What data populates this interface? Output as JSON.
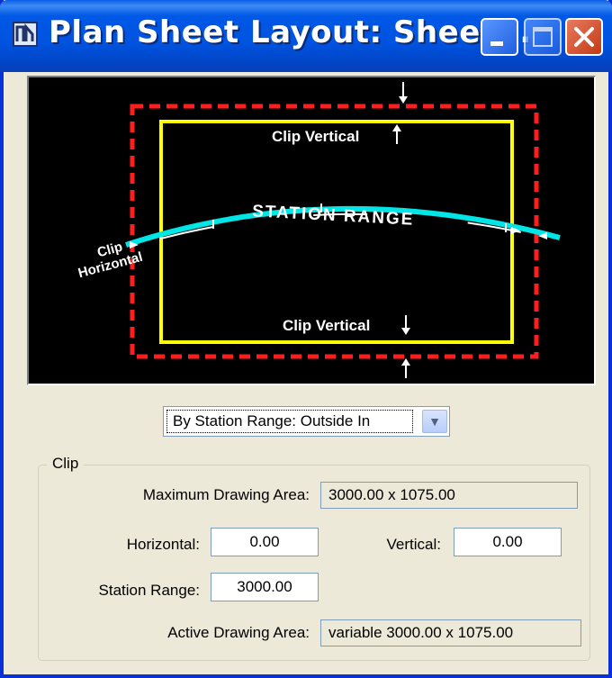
{
  "window": {
    "title": "Plan Sheet Layout: Sheet...",
    "icons": {
      "app": "plan-sheet-app-icon",
      "minimize": "minimize-icon",
      "maximize": "maximize-icon",
      "close": "close-icon"
    }
  },
  "preview": {
    "labels": {
      "clip_vertical_top": "Clip Vertical",
      "clip_vertical_bottom": "Clip Vertical",
      "station_range": "STATION RANGE",
      "clip_horizontal_line1": "Clip",
      "clip_horizontal_line2": "Horizontal"
    },
    "colors": {
      "background": "#000000",
      "outer_border": "#ff1e1e",
      "inner_border": "#ffff00",
      "alignment": "#00e5e5"
    }
  },
  "mode": {
    "selected": "By Station Range: Outside In"
  },
  "clip": {
    "group_label": "Clip",
    "max_area_label": "Maximum Drawing Area:",
    "max_area_value": "3000.00 x  1075.00",
    "horizontal_label": "Horizontal:",
    "horizontal_value": "0.00",
    "vertical_label": "Vertical:",
    "vertical_value": "0.00",
    "station_range_label": "Station Range:",
    "station_range_value": "3000.00",
    "active_area_label": "Active Drawing Area:",
    "active_area_value": "variable  3000.00 x  1075.00"
  }
}
